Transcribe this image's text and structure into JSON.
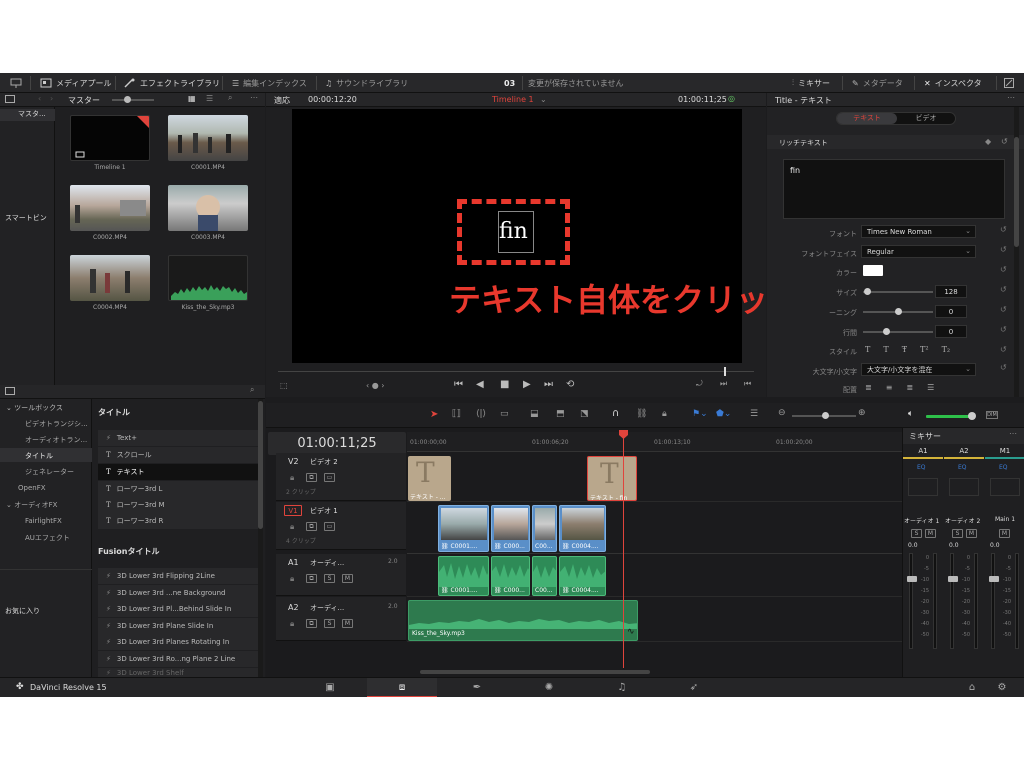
{
  "topbar": {
    "media_pool": "メディアプール",
    "effects_library": "エフェクトライブラリ",
    "edit_index": "編集インデックス",
    "sound_library": "サウンドライブラリ",
    "project_number": "03",
    "save_status": "変更が保存されていません",
    "mixer": "ミキサー",
    "metadata": "メタデータ",
    "inspector": "インスペクタ"
  },
  "media_pool": {
    "bin_label": "マスター",
    "bins": [
      "マスタ...",
      "スマートビン"
    ],
    "clips": [
      "Timeline 1",
      "C0001.MP4",
      "C0002.MP4",
      "C0003.MP4",
      "C0004.MP4",
      "Kiss_the_Sky.mp3"
    ]
  },
  "viewer": {
    "fit": "適応",
    "source_timecode": "00:00:12:20",
    "timeline_name": "Timeline 1",
    "record_timecode": "01:00:11;25",
    "title_text": "fin",
    "annotation": "テキスト自体をクリック"
  },
  "inspector": {
    "title": "Title - テキスト",
    "tab_text": "テキスト",
    "tab_video": "ビデオ",
    "section": "リッチテキスト",
    "text_value": "fin",
    "font_label": "フォント",
    "font_value": "Times New Roman",
    "face_label": "フォントフェイス",
    "face_value": "Regular",
    "color_label": "カラー",
    "size_label": "サイズ",
    "size_value": "128",
    "tracking_label": "ーニング",
    "tracking_value": "0",
    "line_label": "行間",
    "line_value": "0",
    "style_label": "スタイル",
    "case_label": "大文字/小文字",
    "case_value": "大文字/小文字を混在",
    "align_label": "配置"
  },
  "effects": {
    "tree": [
      "ツールボックス",
      "ビデオトランジシ...",
      "オーディオトラン...",
      "タイトル",
      "ジェネレーター",
      "OpenFX",
      "オーディオFX",
      "FairlightFX",
      "AUエフェクト"
    ],
    "favorites": "お気に入り",
    "titles_header": "タイトル",
    "titles": [
      "Text+",
      "スクロール",
      "テキスト",
      "ローワー3rd L",
      "ローワー3rd M",
      "ローワー3rd R"
    ],
    "fusion_header": "Fusionタイトル",
    "fusion": [
      "3D Lower 3rd Flipping 2Line",
      "3D Lower 3rd ...ne Background",
      "3D Lower 3rd Pl...Behind Slide In",
      "3D Lower 3rd Plane Slide In",
      "3D Lower 3rd Planes Rotating In",
      "3D Lower 3rd Ro...ng Plane 2 Line",
      "3D Lower 3rd Shelf"
    ]
  },
  "timeline": {
    "timecode": "01:00:11;25",
    "ruler": [
      "01:00:00;00",
      "01:00:06;20",
      "01:00:13;10",
      "01:00:20;00"
    ],
    "tracks": [
      {
        "id": "V2",
        "name": "ビデオ 2",
        "info": "2 クリップ"
      },
      {
        "id": "V1",
        "name": "ビデオ 1",
        "info": "4 クリップ"
      },
      {
        "id": "A1",
        "name": "オーディ...",
        "level": "2.0"
      },
      {
        "id": "A2",
        "name": "オーディ...",
        "level": "2.0"
      }
    ],
    "title_clip_1": "テキスト - ...",
    "title_clip_2": "テキスト - fin",
    "video_clips": [
      "C0001....",
      "C000...",
      "C00...",
      "C0004...."
    ],
    "audio_clips": [
      "C0001....",
      "C000...",
      "C00...",
      "C0004...."
    ],
    "music_clip": "Kiss_the_Sky.mp3"
  },
  "mixer": {
    "title": "ミキサー",
    "channels": [
      "A1",
      "A2",
      "M1"
    ],
    "eq": "EQ",
    "strip_names": [
      "オーディオ 1",
      "オーディオ 2",
      "Main 1"
    ],
    "solo": "S",
    "mute": "M",
    "level": "0.0",
    "scale": [
      "0",
      "-5",
      "-10",
      "-15",
      "-20",
      "-30",
      "-40",
      "-50"
    ]
  },
  "footer": {
    "app_name": "DaVinci Resolve 15"
  },
  "colors": {
    "accent_red": "#e0443c",
    "annotation_red": "#e8382d",
    "clip_blue": "#5a8fc8",
    "audio_green": "#2e8b57",
    "title_clip": "#b9a78c"
  }
}
